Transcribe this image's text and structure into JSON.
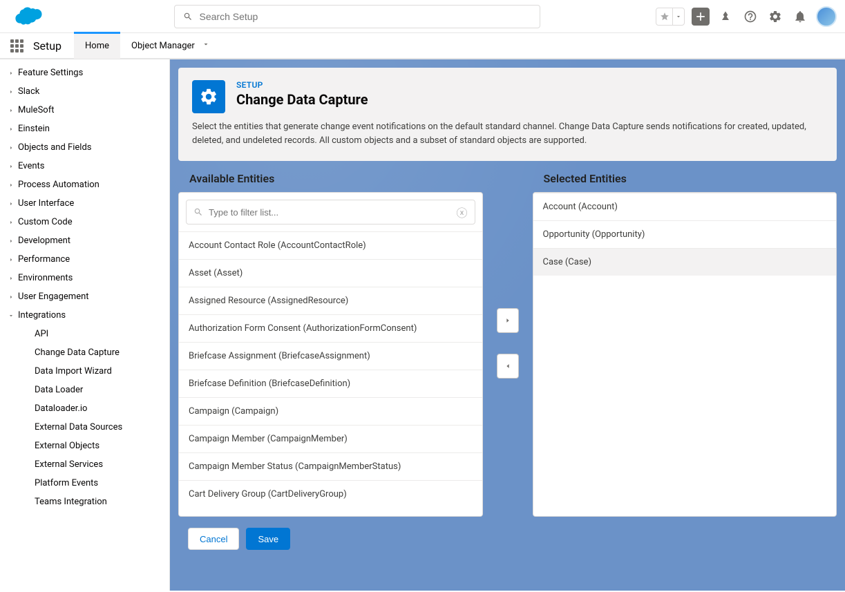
{
  "header": {
    "search_placeholder": "Search Setup"
  },
  "toolbar": {
    "app_title": "Setup",
    "tabs": [
      {
        "label": "Home",
        "active": true
      },
      {
        "label": "Object Manager",
        "dropdown": true
      }
    ]
  },
  "sidebar": {
    "items": [
      {
        "label": "Feature Settings",
        "expandable": true
      },
      {
        "label": "Slack",
        "expandable": true
      },
      {
        "label": "MuleSoft",
        "expandable": true
      },
      {
        "label": "Einstein",
        "expandable": true
      },
      {
        "label": "Objects and Fields",
        "expandable": true
      },
      {
        "label": "Events",
        "expandable": true
      },
      {
        "label": "Process Automation",
        "expandable": true
      },
      {
        "label": "User Interface",
        "expandable": true
      },
      {
        "label": "Custom Code",
        "expandable": true
      },
      {
        "label": "Development",
        "expandable": true
      },
      {
        "label": "Performance",
        "expandable": true
      },
      {
        "label": "Environments",
        "expandable": true
      },
      {
        "label": "User Engagement",
        "expandable": true
      },
      {
        "label": "Integrations",
        "expandable": true,
        "expanded": true,
        "children": [
          {
            "label": "API"
          },
          {
            "label": "Change Data Capture",
            "active": true
          },
          {
            "label": "Data Import Wizard"
          },
          {
            "label": "Data Loader"
          },
          {
            "label": "Dataloader.io"
          },
          {
            "label": "External Data Sources"
          },
          {
            "label": "External Objects"
          },
          {
            "label": "External Services"
          },
          {
            "label": "Platform Events"
          },
          {
            "label": "Teams Integration"
          }
        ]
      }
    ]
  },
  "page": {
    "eyebrow": "SETUP",
    "title": "Change Data Capture",
    "description": "Select the entities that generate change event notifications on the default standard channel. Change Data Capture sends notifications for created, updated, deleted, and undeleted records. All custom objects and a subset of standard objects are supported."
  },
  "picker": {
    "available_label": "Available Entities",
    "selected_label": "Selected Entities",
    "filter_placeholder": "Type to filter list...",
    "available": [
      "Account Contact Role (AccountContactRole)",
      "Asset (Asset)",
      "Assigned Resource (AssignedResource)",
      "Authorization Form Consent (AuthorizationFormConsent)",
      "Briefcase Assignment (BriefcaseAssignment)",
      "Briefcase Definition (BriefcaseDefinition)",
      "Campaign (Campaign)",
      "Campaign Member (CampaignMember)",
      "Campaign Member Status (CampaignMemberStatus)",
      "Cart Delivery Group (CartDeliveryGroup)"
    ],
    "selected": [
      {
        "label": "Account (Account)",
        "highlighted": false
      },
      {
        "label": "Opportunity (Opportunity)",
        "highlighted": false
      },
      {
        "label": "Case (Case)",
        "highlighted": true
      }
    ]
  },
  "actions": {
    "cancel": "Cancel",
    "save": "Save"
  }
}
